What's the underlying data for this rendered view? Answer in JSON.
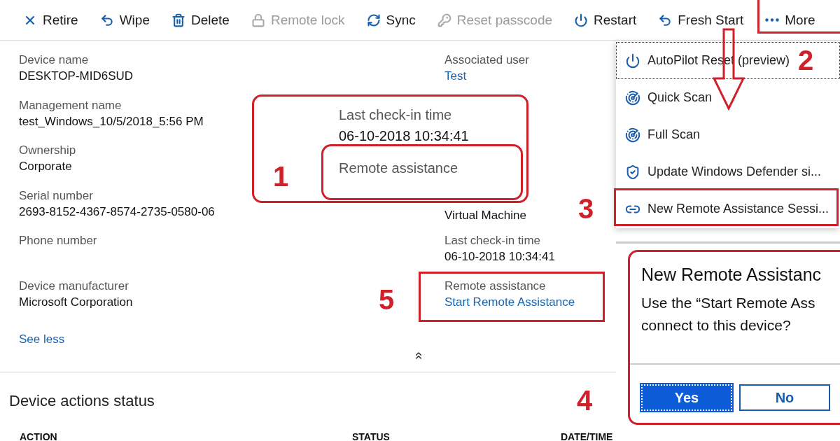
{
  "toolbar": [
    {
      "label": "Retire",
      "disabled": false
    },
    {
      "label": "Wipe",
      "disabled": false
    },
    {
      "label": "Delete",
      "disabled": false
    },
    {
      "label": "Remote lock",
      "disabled": true
    },
    {
      "label": "Sync",
      "disabled": false
    },
    {
      "label": "Reset passcode",
      "disabled": true
    },
    {
      "label": "Restart",
      "disabled": false
    },
    {
      "label": "Fresh Start",
      "disabled": false
    },
    {
      "label": "More",
      "disabled": false
    }
  ],
  "properties_left": [
    {
      "label": "Device name",
      "value": "DESKTOP-MID6SUD"
    },
    {
      "label": "Management name",
      "value": "test_Windows_10/5/2018_5:56 PM"
    },
    {
      "label": "Ownership",
      "value": "Corporate"
    },
    {
      "label": "Serial number",
      "value": "2693-8152-4367-8574-2735-0580-06"
    },
    {
      "label": "Phone number"
    },
    {
      "label": "Device manufacturer",
      "value": "Microsoft Corporation"
    }
  ],
  "see_less": "See less",
  "properties_right": [
    {
      "kind": "text",
      "label": "Associated user",
      "value": "Test",
      "link": true
    },
    {
      "kind": "value_only",
      "value": "Virtual Machine",
      "link": false
    },
    {
      "kind": "text",
      "label": "Last check-in time",
      "value": "06-10-2018 10:34:41",
      "link": false
    },
    {
      "kind": "text",
      "label": "Remote assistance",
      "value": "Start Remote Assistance",
      "link": true
    }
  ],
  "inset": {
    "label": "Last check-in time",
    "value": "06-10-2018 10:34:41",
    "field": "Remote assistance"
  },
  "more_menu": [
    {
      "label": "AutoPilot Reset (preview)",
      "focused": true
    },
    {
      "label": "Quick Scan",
      "focused": false
    },
    {
      "label": "Full Scan",
      "focused": false
    },
    {
      "label": "Update Windows Defender si...",
      "focused": false
    },
    {
      "label": "New Remote Assistance Sessi...",
      "focused": false
    }
  ],
  "dialog": {
    "title": "New Remote Assistanc",
    "message": [
      "Use the “Start Remote Ass",
      "connect to this device?"
    ],
    "buttons": [
      {
        "label": "Yes",
        "primary": true
      },
      {
        "label": "No",
        "primary": false
      }
    ]
  },
  "section": {
    "title": "Device actions status",
    "columns": [
      "ACTION",
      "STATUS",
      "DATE/TIME"
    ]
  },
  "annotations": [
    {
      "kind": "inset",
      "label": "1"
    },
    {
      "kind": "more",
      "label": "2"
    },
    {
      "kind": "menu_item",
      "label": "3"
    },
    {
      "kind": "dialog",
      "label": "4"
    },
    {
      "kind": "field",
      "label": "5"
    }
  ]
}
